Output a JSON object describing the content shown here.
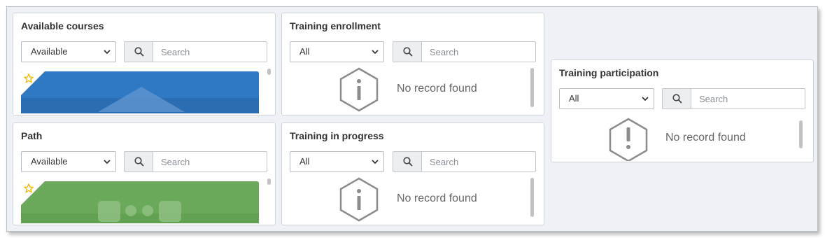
{
  "panels": {
    "available_courses": {
      "title": "Available courses",
      "filter": "Available",
      "search_placeholder": "Search",
      "card_color": "#2f78c4"
    },
    "path": {
      "title": "Path",
      "filter": "Available",
      "search_placeholder": "Search",
      "card_color": "#6aa95a"
    },
    "training_enrollment": {
      "title": "Training enrollment",
      "filter": "All",
      "search_placeholder": "Search",
      "empty_text": "No record found"
    },
    "training_in_progress": {
      "title": "Training in progress",
      "filter": "All",
      "search_placeholder": "Search",
      "empty_text": "No record found"
    },
    "training_participation": {
      "title": "Training participation",
      "filter": "All",
      "search_placeholder": "Search",
      "empty_text": "No record found"
    }
  },
  "icons": {
    "search": "search-icon",
    "chevron": "chevron-down-icon",
    "star": "star-icon",
    "info": "info-icon",
    "warning": "exclamation-icon"
  },
  "colors": {
    "star": "#f0b400",
    "empty_icon": "#8c8c8c",
    "background": "#eef1f5"
  }
}
